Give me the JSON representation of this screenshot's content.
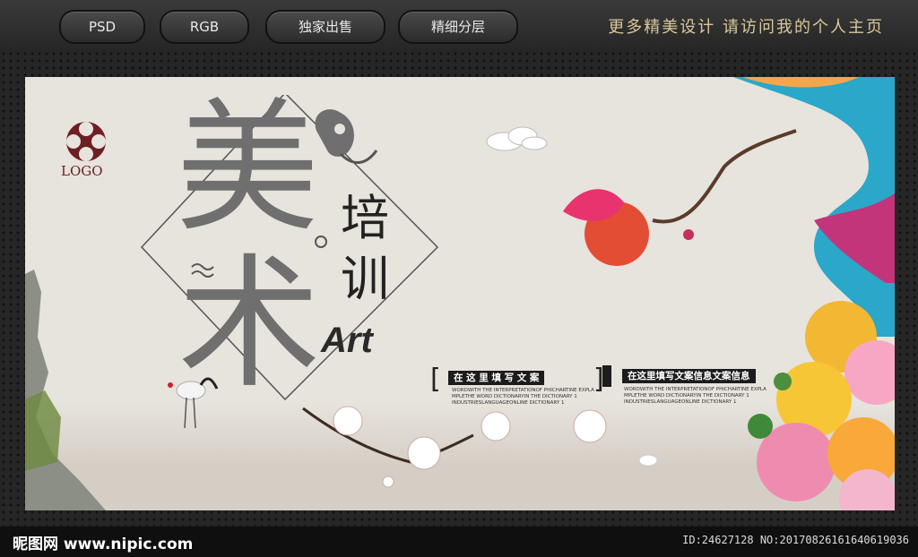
{
  "toolbar": {
    "tabs": [
      {
        "label": "PSD"
      },
      {
        "label": "RGB"
      },
      {
        "label": "独家出售"
      },
      {
        "label": "精细分层"
      }
    ],
    "promo": "更多精美设计  请访问我的个人主页"
  },
  "poster": {
    "logo": "LOGO",
    "char_mei": "美",
    "char_shu": "术",
    "char_pei": "培",
    "char_xun": "训",
    "art": "Art",
    "tag_left": "在 这 里 填 写 文 案",
    "tag_right": "在这里填写文案信息文案信息",
    "fine_lines": [
      "WORDWITH THE INTERPRETATIONOF PHICHARTINE EXPLA",
      "MPLETHE WORD DICTIONARYIN THE DICTIONARY 1",
      "INDUSTRIESLANGUAGEONLINE DICTIONARY 1"
    ],
    "fine_lines_right": [
      "WORDWITH THE INTERPRETATIONOF PHICHARTINE EXPLA",
      "MPLETHE WORD DICTIONARYIN THE DICTIONARY 1",
      "INDUSTRIESLANGUAGEONLINE DICTIONARY 1"
    ]
  },
  "footer": {
    "brand": "昵图网 www.nipic.com",
    "id": "ID:24627128 NO:20170826161640619036"
  },
  "colors": {
    "accent": "#d8c79a",
    "logo": "#6d1f23",
    "sun": "#e34d33"
  }
}
